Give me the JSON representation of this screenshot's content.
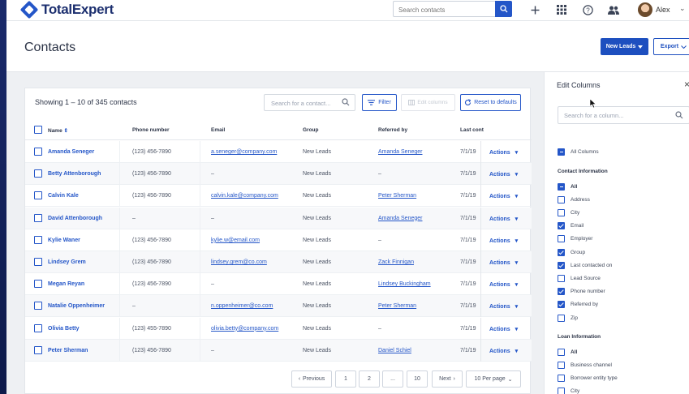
{
  "brand": {
    "name": "TotalExpert"
  },
  "nav": {
    "search_placeholder": "Search contacts",
    "icons": [
      "plus-icon",
      "apps-grid-icon",
      "help-icon",
      "people-icon"
    ],
    "user_name": "Alex"
  },
  "page": {
    "title": "Contacts",
    "new_leads_label": "New Leads",
    "export_label": "Export"
  },
  "table": {
    "showing_text": "Showing 1 – 10 of 345 contacts",
    "search_placeholder": "Search for a contact...",
    "filter_label": "Filter",
    "edit_columns_label": "Edit columns",
    "reset_label": "Reset to defaults",
    "headers": {
      "name": "Name",
      "phone": "Phone number",
      "email": "Email",
      "group": "Group",
      "referred": "Referred by",
      "last": "Last cont"
    },
    "actions_label": "Actions",
    "rows": [
      {
        "name": "Amanda Seneger",
        "phone": "(123) 456-7890",
        "email": "a.seneger@company.com",
        "group": "New Leads",
        "referred": "Amanda Seneger",
        "last": "7/1/19"
      },
      {
        "name": "Betty Attenborough",
        "phone": "(123) 456-7890",
        "email": "–",
        "group": "New Leads",
        "referred": "–",
        "last": "7/1/19"
      },
      {
        "name": "Calvin Kale",
        "phone": "(123) 456-7890",
        "email": "calvin.kale@company.com",
        "group": "New Leads",
        "referred": "Peter Sherman",
        "last": "7/1/19"
      },
      {
        "name": "David Attenborough",
        "phone": "–",
        "email": "–",
        "group": "New Leads",
        "referred": "Amanda Seneger",
        "last": "7/1/19"
      },
      {
        "name": "Kylie Waner",
        "phone": "(123) 456-7890",
        "email": "kylie.w@email.com",
        "group": "New Leads",
        "referred": "–",
        "last": "7/1/19"
      },
      {
        "name": "Lindsey Grem",
        "phone": "(123) 456-7890",
        "email": "lindsey.grem@co.com",
        "group": "New Leads",
        "referred": "Zack Finnigan",
        "last": "7/1/19"
      },
      {
        "name": "Megan Reyan",
        "phone": "(123) 456-7890",
        "email": "–",
        "group": "New Leads",
        "referred": "Lindsey Buckingham",
        "last": "7/1/19"
      },
      {
        "name": "Natalie Oppenheimer",
        "phone": "–",
        "email": "n.oppenheimer@co.com",
        "group": "New Leads",
        "referred": "Peter Sherman",
        "last": "7/1/19"
      },
      {
        "name": "Olivia Betty",
        "phone": "(123) 455-7890",
        "email": "olivia.betty@company.com",
        "group": "New Leads",
        "referred": "–",
        "last": "7/1/19"
      },
      {
        "name": "Peter Sherman",
        "phone": "(123) 456-7890",
        "email": "–",
        "group": "New Leads",
        "referred": "Daniel Schiel",
        "last": "7/1/19"
      }
    ]
  },
  "pagination": {
    "previous": "Previous",
    "pages": [
      "1",
      "2",
      "...",
      "10"
    ],
    "next": "Next",
    "per_page": "10 Per page"
  },
  "edit_columns": {
    "title": "Edit Columns",
    "search_placeholder": "Search for a column...",
    "all_columns_label": "All Columns",
    "contact_section": "Contact Information",
    "contact_items": [
      {
        "label": "All",
        "state": "indeterminate"
      },
      {
        "label": "Address",
        "state": "unchecked"
      },
      {
        "label": "City",
        "state": "unchecked"
      },
      {
        "label": "Email",
        "state": "checked"
      },
      {
        "label": "Employer",
        "state": "unchecked"
      },
      {
        "label": "Group",
        "state": "checked"
      },
      {
        "label": "Last contacted on",
        "state": "checked"
      },
      {
        "label": "Lead Source",
        "state": "unchecked"
      },
      {
        "label": "Phone number",
        "state": "checked"
      },
      {
        "label": "Referred by",
        "state": "checked"
      },
      {
        "label": "Zip",
        "state": "unchecked"
      }
    ],
    "loan_section": "Loan Information",
    "loan_items": [
      {
        "label": "All",
        "state": "unchecked"
      },
      {
        "label": "Business channel",
        "state": "unchecked"
      },
      {
        "label": "Borrower entity type",
        "state": "unchecked"
      },
      {
        "label": "City",
        "state": "unchecked"
      }
    ]
  },
  "colors": {
    "primary": "#2456c8",
    "brand_dark": "#1c2f6f"
  }
}
